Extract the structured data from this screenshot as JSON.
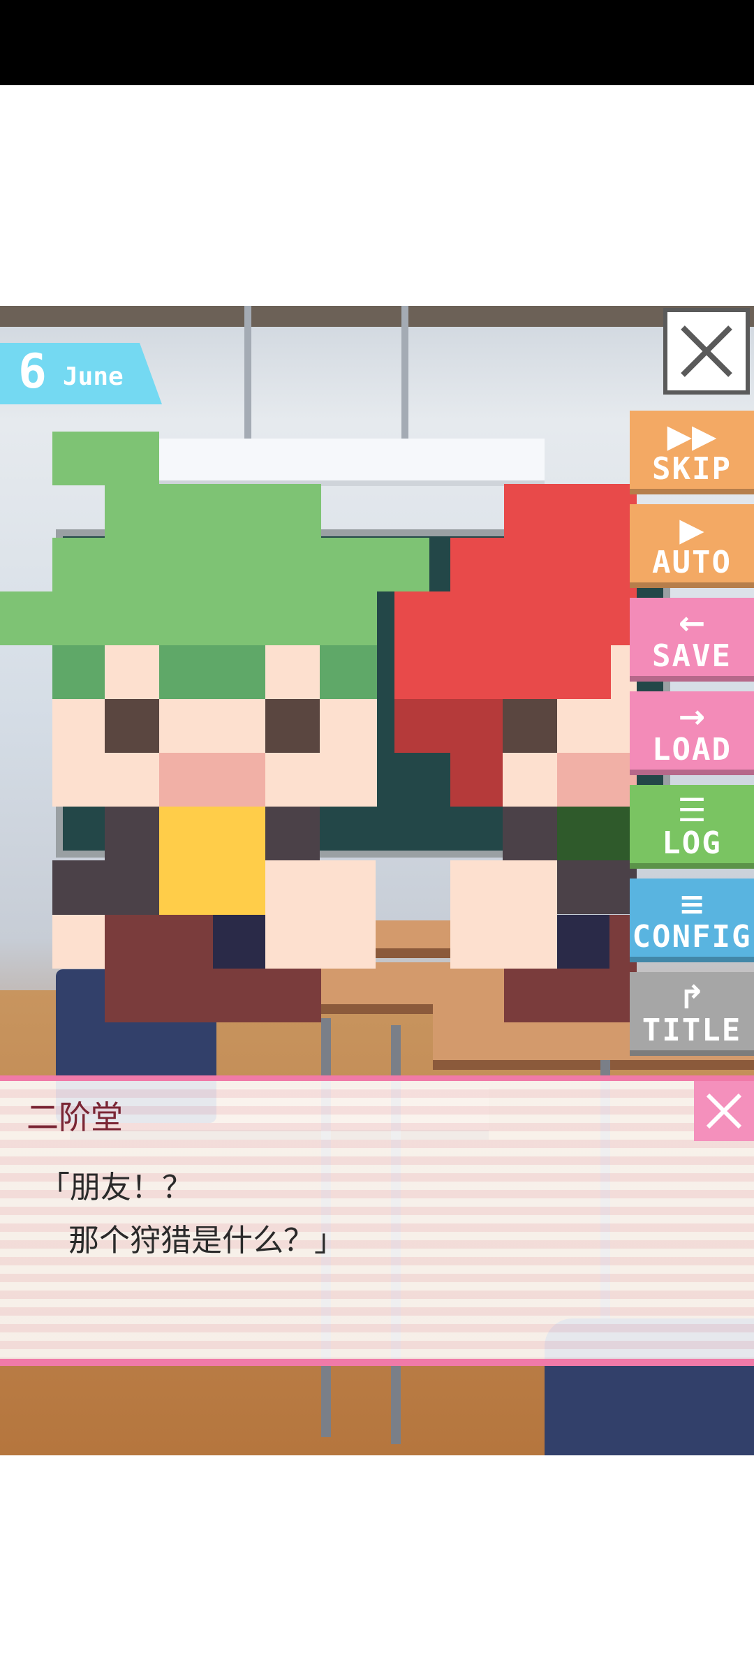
{
  "date": {
    "day": "6",
    "month": "June"
  },
  "menu": [
    {
      "icon": "▶▶",
      "label": "SKIP",
      "color": "#f3a964"
    },
    {
      "icon": "▶",
      "label": "AUTO",
      "color": "#f3a964"
    },
    {
      "icon": "←",
      "label": "SAVE",
      "color": "#f38bb8"
    },
    {
      "icon": "→",
      "label": "LOAD",
      "color": "#f38bb8"
    },
    {
      "icon": "☰",
      "label": "LOG",
      "color": "#7ac462"
    },
    {
      "icon": "≡",
      "label": "CONFIG",
      "color": "#59b4e0"
    },
    {
      "icon": "↱",
      "label": "TITLE",
      "color": "#a6a6a6"
    }
  ],
  "dialog": {
    "speaker": "二阶堂",
    "line1": "「朋友！？",
    "line2": "那个狩猎是什么？」"
  },
  "colors": {
    "accent_pink": "#f07aa8",
    "date_tag": "#74d9f2",
    "green_hair": "#7ec374",
    "red_hair": "#e84a4a"
  }
}
